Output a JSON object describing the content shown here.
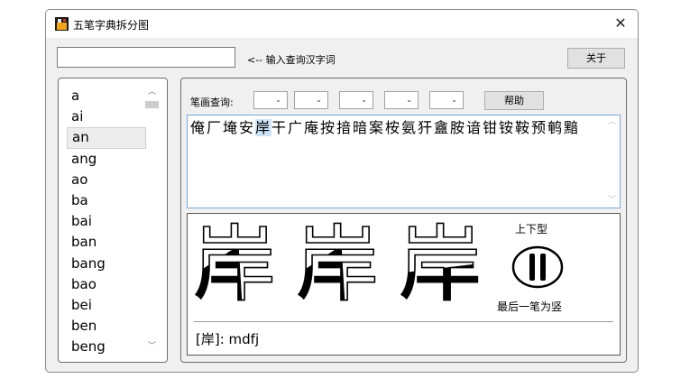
{
  "window": {
    "title": "五笔字典拆分图",
    "close_glyph": "✕"
  },
  "toolbar": {
    "search_value": "",
    "hint": "<-- 输入查询汉字词",
    "about_label": "关于"
  },
  "pinyin_list": {
    "items": [
      "a",
      "ai",
      "an",
      "ang",
      "ao",
      "ba",
      "bai",
      "ban",
      "bang",
      "bao",
      "bei",
      "ben",
      "beng"
    ],
    "selected": "an"
  },
  "stroke_query": {
    "label": "笔画查询:",
    "help_label": "帮助",
    "dropdown_arrow": "⌄"
  },
  "results": {
    "before": "俺厂埯安",
    "highlight": "岸",
    "after": "干广庵按揞暗案桉氨犴盦胺谙钳铵鞍预鹌黯"
  },
  "decomposition": {
    "character": "岸",
    "structure": "上下型",
    "last_stroke": "最后一笔为竖",
    "code_line": "[岸]: mdfj"
  },
  "icons": {
    "app": "app-icon",
    "close": "close-icon",
    "scroll_up": "chevron-up-icon",
    "scroll_down": "chevron-down-icon"
  }
}
